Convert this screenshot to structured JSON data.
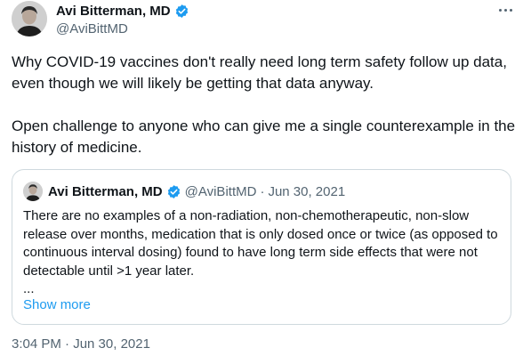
{
  "author": {
    "name": "Avi Bitterman, MD",
    "handle": "@AviBittMD",
    "verified_icon": "verified-badge-icon",
    "verified_color": "#1d9bf0"
  },
  "tweet": {
    "paragraph1": "Why COVID-19 vaccines don't really need long term safety follow up data, even though we will likely be getting that data anyway.",
    "paragraph2": "Open challenge to anyone who can give me a single counterexample in the history of medicine.",
    "timestamp": "3:04 PM · Jun 30, 2021"
  },
  "quote": {
    "name": "Avi Bitterman, MD",
    "handle": "@AviBittMD",
    "separator": "·",
    "date": "Jun 30, 2021",
    "text": "There are no examples of a non-radiation, non-chemotherapeutic, non-slow release over months, medication that is only dosed once or twice (as opposed to continuous interval dosing) found to have long term side effects that were not detectable until >1 year later.",
    "ellipsis": "...",
    "show_more_label": "Show more"
  },
  "colors": {
    "text": "#0f1419",
    "secondary": "#536471",
    "accent": "#1d9bf0",
    "border": "#cfd9de"
  }
}
